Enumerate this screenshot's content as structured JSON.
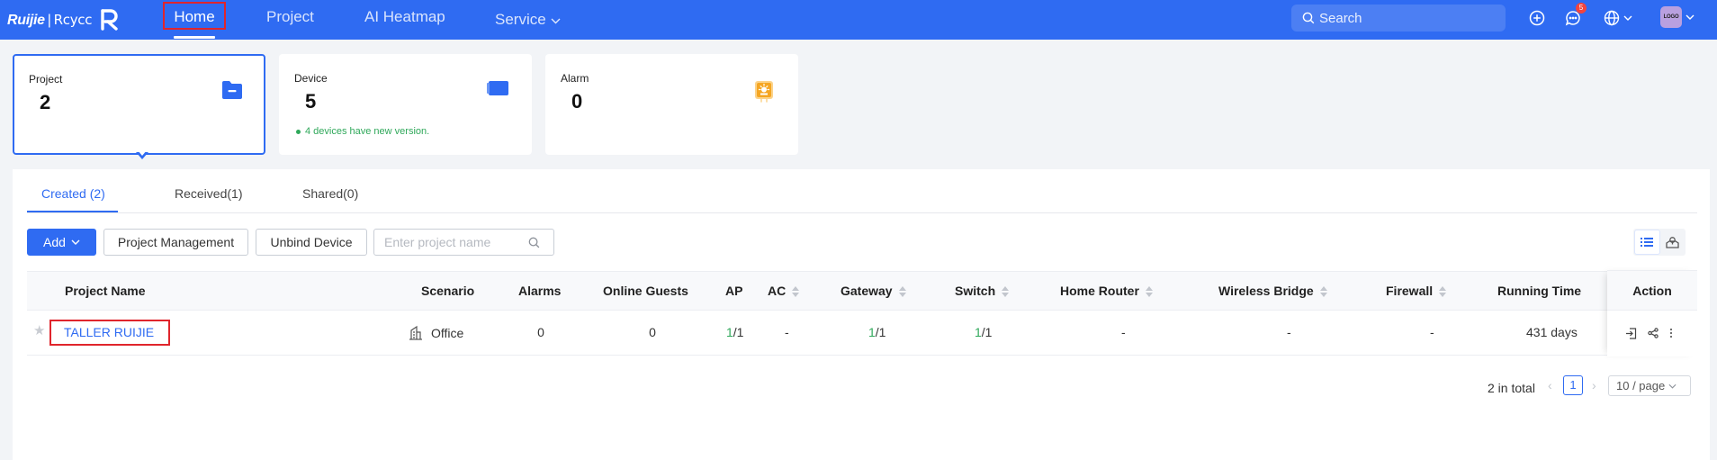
{
  "brand": {
    "name": "Ruijie",
    "divider": "|",
    "product": "Rcycc"
  },
  "nav": {
    "home": "Home",
    "project": "Project",
    "heatmap": "AI Heatmap",
    "service": "Service"
  },
  "header": {
    "search_placeholder": "Search",
    "message_count": "5",
    "avatar_text": "LOGO"
  },
  "cards": {
    "project": {
      "label": "Project",
      "value": "2"
    },
    "device": {
      "label": "Device",
      "value": "5",
      "note": "4 devices have new version."
    },
    "alarm": {
      "label": "Alarm",
      "value": "0"
    }
  },
  "tabs": {
    "created": "Created (2)",
    "received": "Received(1)",
    "shared": "Shared(0)"
  },
  "toolbar": {
    "add": "Add",
    "project_management": "Project Management",
    "unbind_device": "Unbind Device",
    "search_placeholder": "Enter project name"
  },
  "table": {
    "headers": {
      "project_name": "Project Name",
      "scenario": "Scenario",
      "alarms": "Alarms",
      "online_guests": "Online Guests",
      "ap": "AP",
      "ac": "AC",
      "gateway": "Gateway",
      "switch": "Switch",
      "home_router": "Home Router",
      "wireless_bridge": "Wireless Bridge",
      "firewall": "Firewall",
      "running_time": "Running Time",
      "action": "Action"
    },
    "row": {
      "project_name": "TALLER RUIJIE",
      "scenario": "Office",
      "alarms": "0",
      "online_guests": "0",
      "ap_online": "1",
      "ap_total": "/1",
      "ac": "-",
      "gateway_online": "1",
      "gateway_total": "/1",
      "switch_online": "1",
      "switch_total": "/1",
      "home_router": "-",
      "wireless_bridge": "-",
      "firewall": "-",
      "running_time": "431 days"
    }
  },
  "pagination": {
    "total": "2 in total",
    "current": "1",
    "page_size": "10 / page"
  },
  "colors": {
    "primary": "#2f6bf2",
    "highlight": "#e0252c",
    "online": "#2fa85a",
    "alarm_icon": "#f5a623"
  }
}
